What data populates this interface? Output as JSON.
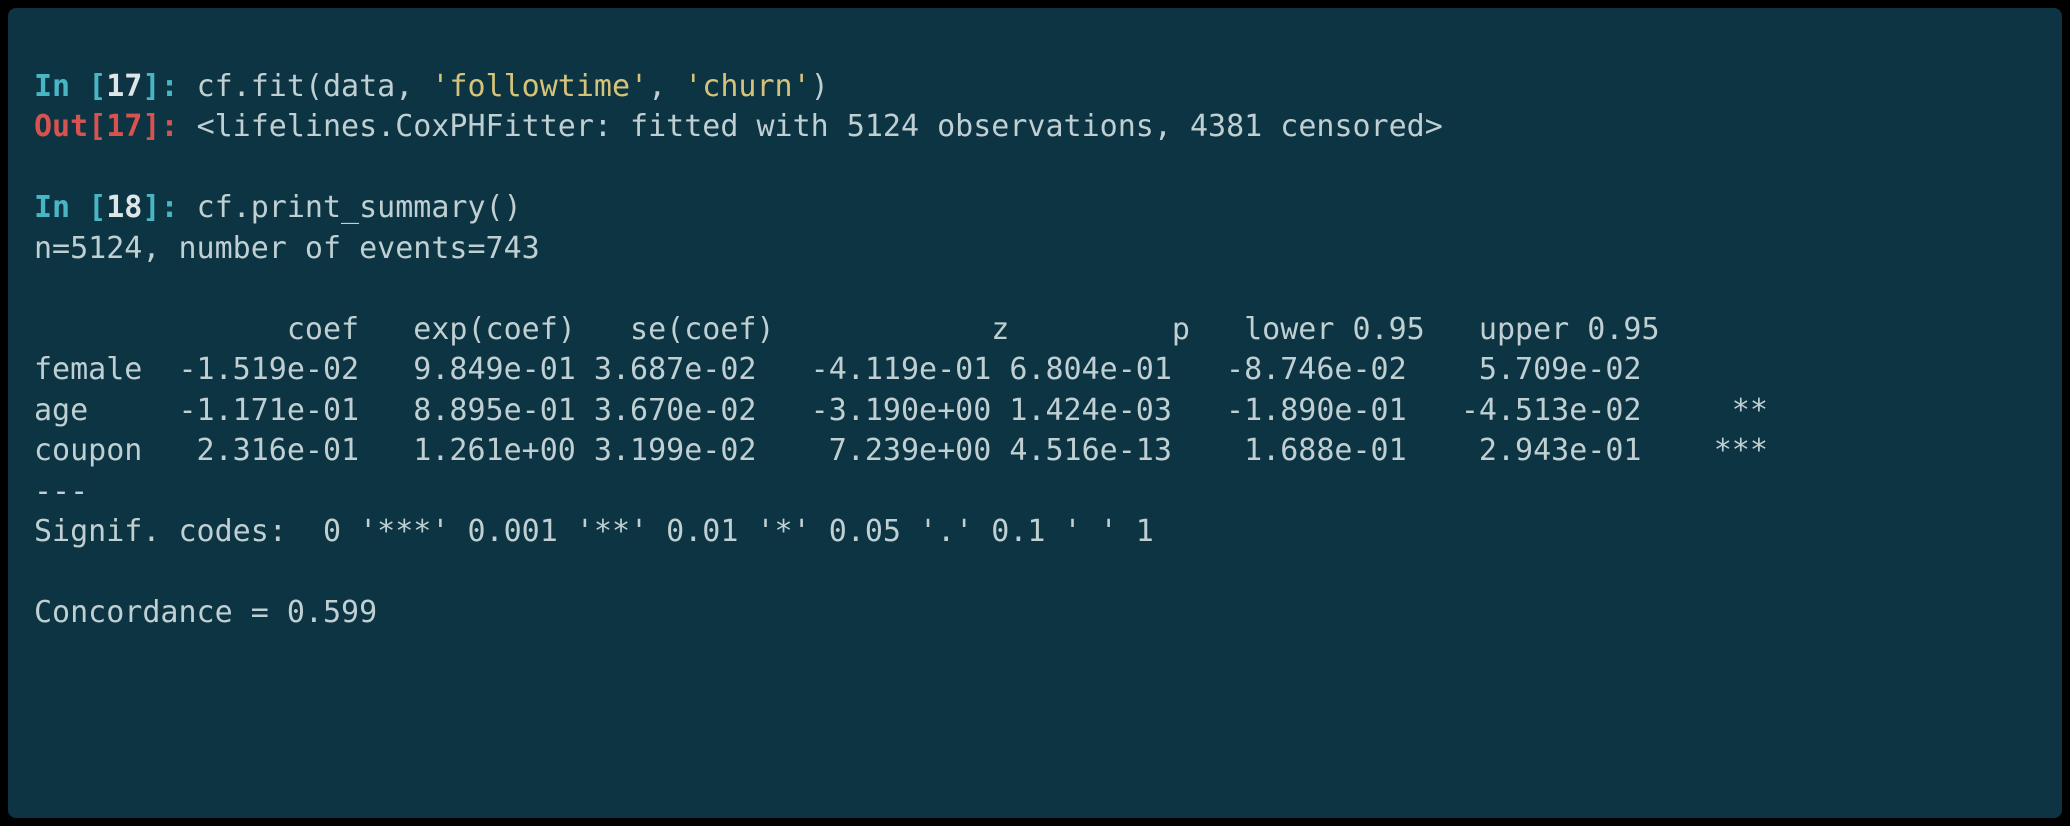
{
  "cells": [
    {
      "in_num": "17",
      "code_parts": {
        "fn": "cf.fit",
        "open": "(",
        "arg": "data",
        "sep": ", ",
        "s1": "'followtime'",
        "s2": "'churn'",
        "close": ")"
      },
      "out_num": "17",
      "out_text": "<lifelines.CoxPHFitter: fitted with 5124 observations, 4381 censored>"
    },
    {
      "in_num": "18",
      "code_parts": {
        "fn": "cf.print_summary",
        "open": "(",
        "close": ")"
      },
      "stdout": {
        "header_line": "n=5124, number of events=743",
        "columns": [
          "coef",
          "exp(coef)",
          "se(coef)",
          "z",
          "p",
          "lower 0.95",
          "upper 0.95"
        ],
        "rows": [
          {
            "name": "female",
            "coef": "-1.519e-02",
            "exp": "9.849e-01",
            "se": "3.687e-02",
            "z": "-4.119e-01",
            "p": "6.804e-01",
            "lo": "-8.746e-02",
            "hi": "5.709e-02",
            "sig": ""
          },
          {
            "name": "age",
            "coef": "-1.171e-01",
            "exp": "8.895e-01",
            "se": "3.670e-02",
            "z": "-3.190e+00",
            "p": "1.424e-03",
            "lo": "-1.890e-01",
            "hi": "-4.513e-02",
            "sig": "**"
          },
          {
            "name": "coupon",
            "coef": "2.316e-01",
            "exp": "1.261e+00",
            "se": "3.199e-02",
            "z": "7.239e+00",
            "p": "4.516e-13",
            "lo": "1.688e-01",
            "hi": "2.943e-01",
            "sig": "***"
          }
        ],
        "sep": "---",
        "signif": "Signif. codes:  0 '***' 0.001 '**' 0.01 '*' 0.05 '.' 0.1 ' ' 1",
        "concordance": "Concordance = 0.599"
      }
    }
  ]
}
